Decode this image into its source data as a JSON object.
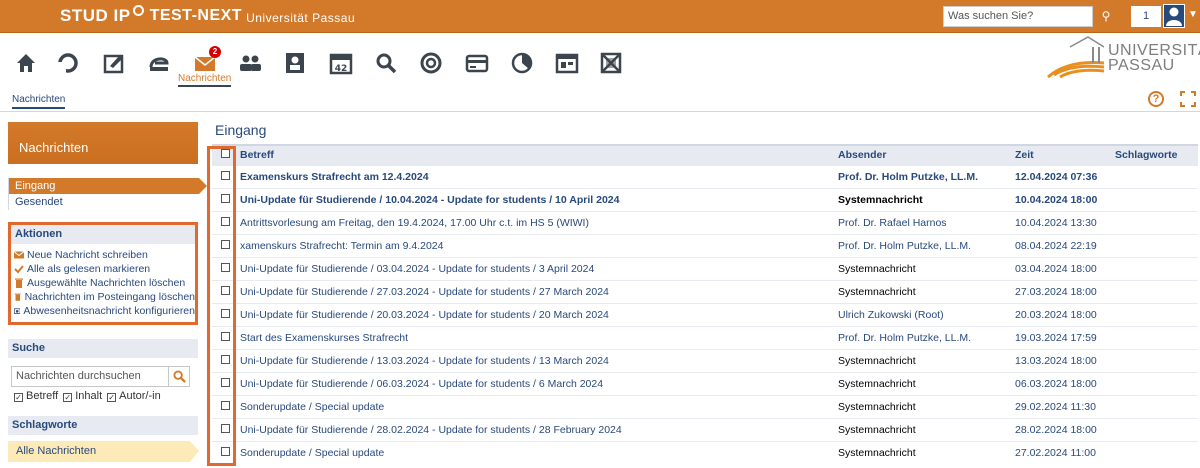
{
  "topbar": {
    "logo_text": "STUD IP",
    "instance": "TEST-NEXT",
    "university": "Universität Passau",
    "search_placeholder": "Was suchen Sie?",
    "notification_count": "1"
  },
  "nav": {
    "active_label": "Nachrichten",
    "badge": "2",
    "icons": [
      "home-icon",
      "activity-icon",
      "workplace-icon",
      "courses-icon",
      "messages-icon",
      "community-icon",
      "profile-icon",
      "schedule-icon",
      "search-icon",
      "tools-icon",
      "admin-icon",
      "stats-icon",
      "rooms-icon",
      "disabled-icon"
    ]
  },
  "uni_logo": {
    "line1": "UNIVERSITÄT",
    "line2": "PASSAU"
  },
  "subnav": {
    "tab": "Nachrichten"
  },
  "sidebar": {
    "header": "Nachrichten",
    "folders": [
      {
        "label": "Eingang",
        "active": true
      },
      {
        "label": "Gesendet",
        "active": false
      }
    ],
    "actions_title": "Aktionen",
    "actions": [
      {
        "label": "Neue Nachricht schreiben",
        "icon": "envelope-icon"
      },
      {
        "label": "Alle als gelesen markieren",
        "icon": "check-icon"
      },
      {
        "label": "Ausgewählte Nachrichten löschen",
        "icon": "trash-icon"
      },
      {
        "label": "Nachrichten im Posteingang löschen",
        "icon": "trash-icon"
      },
      {
        "label": "Abwesenheitsnachricht konfigurieren",
        "icon": "settings-icon"
      }
    ],
    "search_title": "Suche",
    "search_placeholder": "Nachrichten durchsuchen",
    "search_options": [
      "Betreff",
      "Inhalt",
      "Autor/-in"
    ],
    "tags_title": "Schlagworte",
    "tags_all": "Alle Nachrichten"
  },
  "main": {
    "title": "Eingang",
    "columns": [
      "Betreff",
      "Absender",
      "Zeit",
      "Schlagworte"
    ],
    "rows": [
      {
        "subject": "Examenskurs Strafrecht am 12.4.2024",
        "sender": "Prof. Dr. Holm Putzke, LL.M.",
        "date": "12.04.2024 07:36",
        "unread": true,
        "system": false
      },
      {
        "subject": "Uni-Update für Studierende / 10.04.2024 - Update for students / 10 April 2024",
        "sender": "Systemnachricht",
        "date": "10.04.2024 18:00",
        "unread": true,
        "system": true
      },
      {
        "subject": "Antrittsvorlesung am Freitag, den 19.4.2024, 17.00 Uhr c.t. im HS 5 (WIWI)",
        "sender": "Prof. Dr. Rafael Harnos",
        "date": "10.04.2024 13:30",
        "unread": false,
        "system": false
      },
      {
        "subject": "xamenskurs Strafrecht: Termin am 9.4.2024",
        "sender": "Prof. Dr. Holm Putzke, LL.M.",
        "date": "08.04.2024 22:19",
        "unread": false,
        "system": false
      },
      {
        "subject": "Uni-Update für Studierende / 03.04.2024 - Update for students / 3 April 2024",
        "sender": "Systemnachricht",
        "date": "03.04.2024 18:00",
        "unread": false,
        "system": true
      },
      {
        "subject": "Uni-Update für Studierende / 27.03.2024 - Update for students / 27 March 2024",
        "sender": "Systemnachricht",
        "date": "27.03.2024 18:00",
        "unread": false,
        "system": true
      },
      {
        "subject": "Uni-Update für Studierende / 20.03.2024 - Update for students / 20 March 2024",
        "sender": "Ulrich Zukowski (Root)",
        "date": "20.03.2024 18:00",
        "unread": false,
        "system": false
      },
      {
        "subject": "Start des Examenskurses Strafrecht",
        "sender": "Prof. Dr. Holm Putzke, LL.M.",
        "date": "19.03.2024 17:59",
        "unread": false,
        "system": false
      },
      {
        "subject": "Uni-Update für Studierende / 13.03.2024 - Update for students / 13 March 2024",
        "sender": "Systemnachricht",
        "date": "13.03.2024 18:00",
        "unread": false,
        "system": true
      },
      {
        "subject": "Uni-Update für Studierende / 06.03.2024 - Update for students / 6 March 2024",
        "sender": "Systemnachricht",
        "date": "06.03.2024 18:00",
        "unread": false,
        "system": true
      },
      {
        "subject": "Sonderupdate / Special update",
        "sender": "Systemnachricht",
        "date": "29.02.2024 11:30",
        "unread": false,
        "system": true
      },
      {
        "subject": "Uni-Update für Studierende / 28.02.2024 - Update for students / 28 February 2024",
        "sender": "Systemnachricht",
        "date": "28.02.2024 18:00",
        "unread": false,
        "system": true
      },
      {
        "subject": "Sonderupdate / Special update",
        "sender": "Systemnachricht",
        "date": "27.02.2024 11:00",
        "unread": false,
        "system": true
      }
    ]
  },
  "colors": {
    "accent": "#d37a2a",
    "link": "#28497c",
    "highlight": "#e2692e"
  }
}
